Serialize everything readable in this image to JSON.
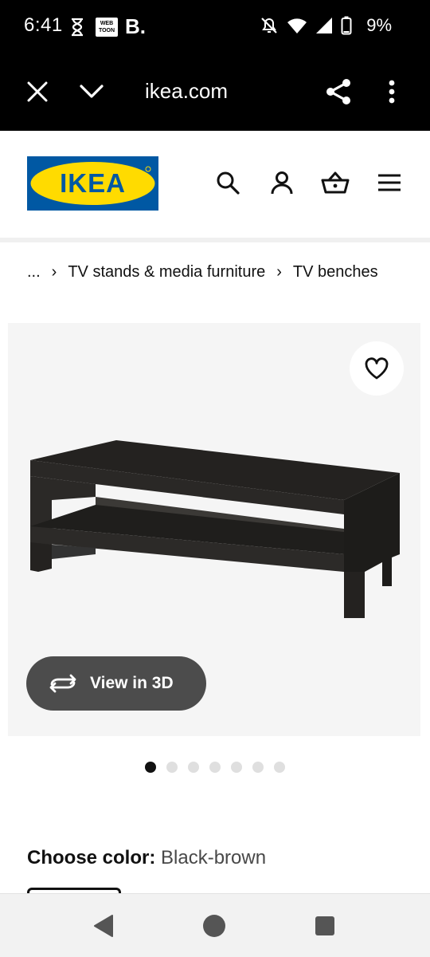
{
  "status_bar": {
    "time": "6:41",
    "webtoon_label": "WEB TOON",
    "b_label": "B.",
    "battery": "9%"
  },
  "browser": {
    "url": "ikea.com",
    "close_icon": "close-icon",
    "tabs_icon": "chevron-down-icon",
    "share_icon": "share-icon",
    "menu_icon": "more-vertical-icon"
  },
  "header": {
    "logo_text": "IKEA",
    "logo_colors": {
      "blue": "#0058a3",
      "yellow": "#ffdb00"
    },
    "icons": [
      "search-icon",
      "account-icon",
      "cart-icon",
      "menu-icon"
    ]
  },
  "breadcrumb": {
    "ellipsis": "...",
    "items": [
      "TV stands & media furniture",
      "TV benches"
    ],
    "separator": "›"
  },
  "product": {
    "favorite_icon": "heart-icon",
    "view_3d_label": "View in 3D",
    "image_count": 7,
    "active_image": 1
  },
  "color": {
    "label": "Choose color:",
    "value": "Black-brown"
  },
  "nav_bar": {
    "buttons": [
      "back-icon",
      "home-icon",
      "recents-icon"
    ]
  }
}
